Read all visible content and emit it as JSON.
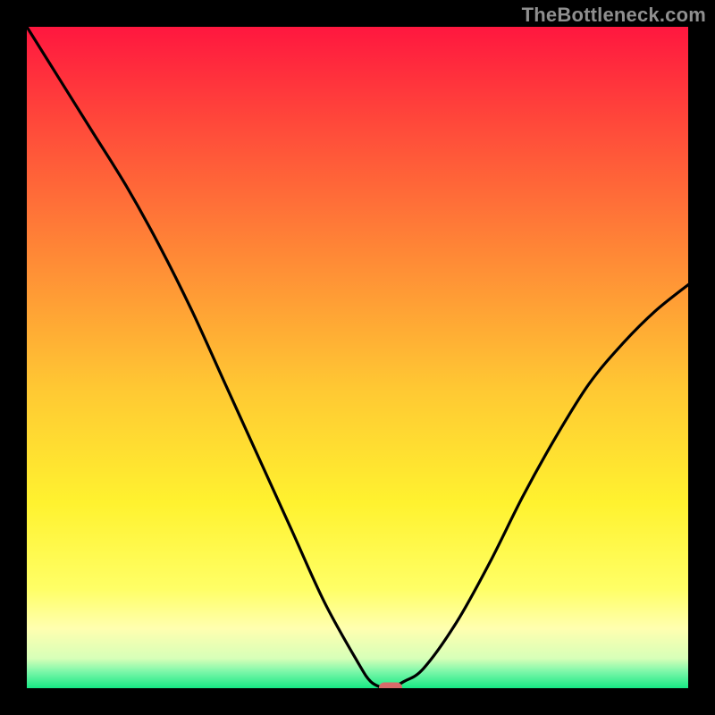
{
  "watermark": "TheBottleneck.com",
  "chart_data": {
    "type": "line",
    "title": "",
    "xlabel": "",
    "ylabel": "",
    "xlim": [
      0,
      100
    ],
    "ylim": [
      0,
      100
    ],
    "series": [
      {
        "name": "bottleneck-curve",
        "x": [
          0,
          5,
          10,
          15,
          20,
          25,
          30,
          35,
          40,
          45,
          50,
          52,
          54,
          55,
          57,
          60,
          65,
          70,
          75,
          80,
          85,
          90,
          95,
          100
        ],
        "y": [
          100,
          92,
          84,
          76,
          67,
          57,
          46,
          35,
          24,
          13,
          4,
          1,
          0,
          0,
          1,
          3,
          10,
          19,
          29,
          38,
          46,
          52,
          57,
          61
        ]
      }
    ],
    "marker": {
      "x": 55,
      "y": 0,
      "color": "#d86a6a"
    },
    "gradient_stops": [
      {
        "offset": 0.0,
        "color": "#ff173f"
      },
      {
        "offset": 0.15,
        "color": "#ff4a3a"
      },
      {
        "offset": 0.35,
        "color": "#ff8a36"
      },
      {
        "offset": 0.55,
        "color": "#ffc933"
      },
      {
        "offset": 0.72,
        "color": "#fff22f"
      },
      {
        "offset": 0.85,
        "color": "#ffff66"
      },
      {
        "offset": 0.91,
        "color": "#ffffb0"
      },
      {
        "offset": 0.955,
        "color": "#d7ffb8"
      },
      {
        "offset": 0.975,
        "color": "#7cf7a9"
      },
      {
        "offset": 1.0,
        "color": "#17e884"
      }
    ]
  }
}
